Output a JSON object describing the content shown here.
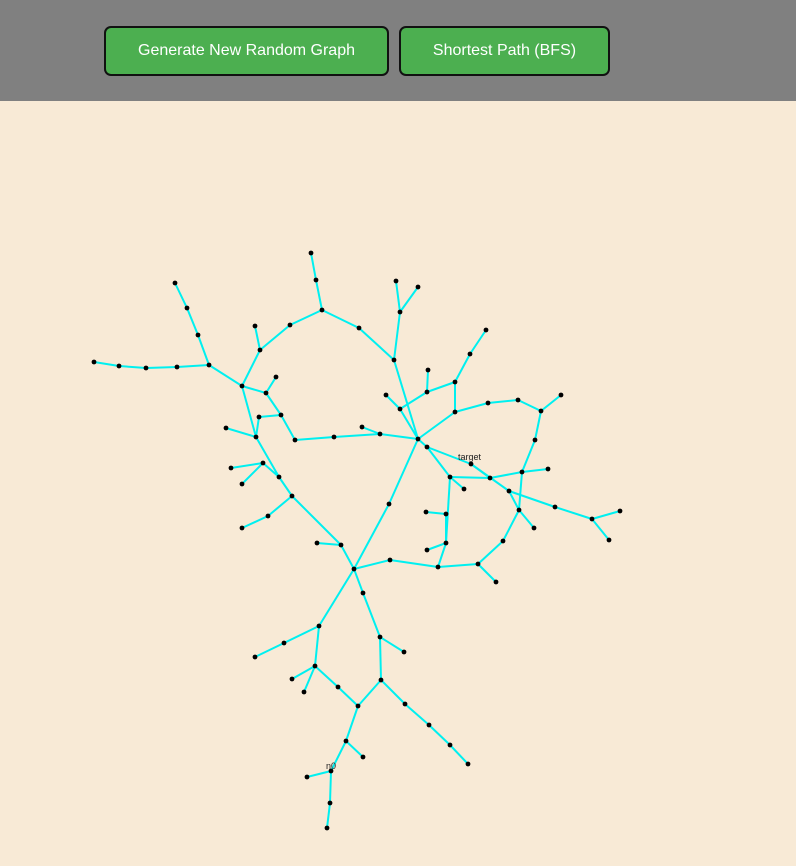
{
  "toolbar": {
    "generate_label": "Generate New Random Graph",
    "bfs_label": "Shortest Path (BFS)"
  },
  "colors": {
    "toolbar_bg": "#808080",
    "button_bg": "#4caf50",
    "canvas_bg": "#f8ead6",
    "edge": "#00f0f0",
    "node": "#000000"
  },
  "graph": {
    "labels": {
      "source": "n0",
      "target": "target"
    }
  }
}
